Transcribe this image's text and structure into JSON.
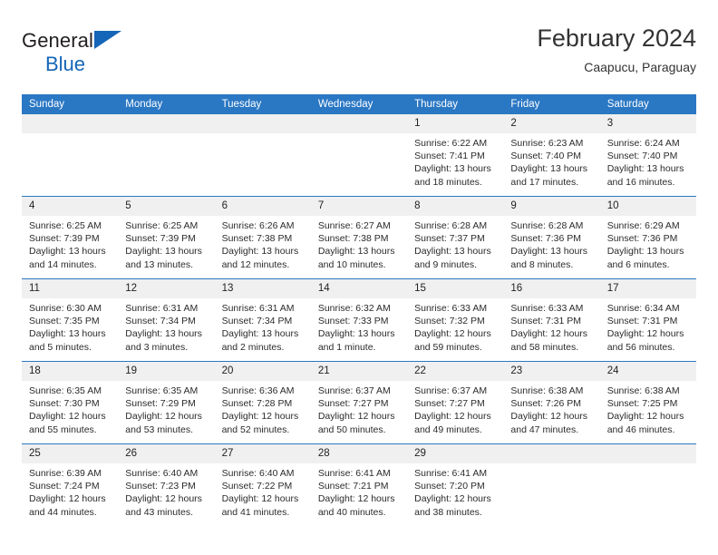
{
  "brand": {
    "name_top": "General",
    "name_bottom": "Blue",
    "triangle_color": "#1565b8",
    "icon": "triangle-icon"
  },
  "header": {
    "title": "February 2024",
    "subtitle": "Caapucu, Paraguay"
  },
  "theme": {
    "header_bg": "#2a77c4",
    "header_text": "#ffffff",
    "daynum_bg": "#f0f0f0",
    "grid_line": "#2a77c4",
    "body_text": "#2b2b2b"
  },
  "weekday_headers": [
    "Sunday",
    "Monday",
    "Tuesday",
    "Wednesday",
    "Thursday",
    "Friday",
    "Saturday"
  ],
  "labels": {
    "sunrise_prefix": "Sunrise:",
    "sunset_prefix": "Sunset:",
    "daylight_prefix": "Daylight:"
  },
  "weeks": [
    [
      {
        "day": "",
        "blank": true
      },
      {
        "day": "",
        "blank": true
      },
      {
        "day": "",
        "blank": true
      },
      {
        "day": "",
        "blank": true
      },
      {
        "day": "1",
        "sunrise": "Sunrise: 6:22 AM",
        "sunset": "Sunset: 7:41 PM",
        "daylight": "Daylight: 13 hours and 18 minutes."
      },
      {
        "day": "2",
        "sunrise": "Sunrise: 6:23 AM",
        "sunset": "Sunset: 7:40 PM",
        "daylight": "Daylight: 13 hours and 17 minutes."
      },
      {
        "day": "3",
        "sunrise": "Sunrise: 6:24 AM",
        "sunset": "Sunset: 7:40 PM",
        "daylight": "Daylight: 13 hours and 16 minutes."
      }
    ],
    [
      {
        "day": "4",
        "sunrise": "Sunrise: 6:25 AM",
        "sunset": "Sunset: 7:39 PM",
        "daylight": "Daylight: 13 hours and 14 minutes."
      },
      {
        "day": "5",
        "sunrise": "Sunrise: 6:25 AM",
        "sunset": "Sunset: 7:39 PM",
        "daylight": "Daylight: 13 hours and 13 minutes."
      },
      {
        "day": "6",
        "sunrise": "Sunrise: 6:26 AM",
        "sunset": "Sunset: 7:38 PM",
        "daylight": "Daylight: 13 hours and 12 minutes."
      },
      {
        "day": "7",
        "sunrise": "Sunrise: 6:27 AM",
        "sunset": "Sunset: 7:38 PM",
        "daylight": "Daylight: 13 hours and 10 minutes."
      },
      {
        "day": "8",
        "sunrise": "Sunrise: 6:28 AM",
        "sunset": "Sunset: 7:37 PM",
        "daylight": "Daylight: 13 hours and 9 minutes."
      },
      {
        "day": "9",
        "sunrise": "Sunrise: 6:28 AM",
        "sunset": "Sunset: 7:36 PM",
        "daylight": "Daylight: 13 hours and 8 minutes."
      },
      {
        "day": "10",
        "sunrise": "Sunrise: 6:29 AM",
        "sunset": "Sunset: 7:36 PM",
        "daylight": "Daylight: 13 hours and 6 minutes."
      }
    ],
    [
      {
        "day": "11",
        "sunrise": "Sunrise: 6:30 AM",
        "sunset": "Sunset: 7:35 PM",
        "daylight": "Daylight: 13 hours and 5 minutes."
      },
      {
        "day": "12",
        "sunrise": "Sunrise: 6:31 AM",
        "sunset": "Sunset: 7:34 PM",
        "daylight": "Daylight: 13 hours and 3 minutes."
      },
      {
        "day": "13",
        "sunrise": "Sunrise: 6:31 AM",
        "sunset": "Sunset: 7:34 PM",
        "daylight": "Daylight: 13 hours and 2 minutes."
      },
      {
        "day": "14",
        "sunrise": "Sunrise: 6:32 AM",
        "sunset": "Sunset: 7:33 PM",
        "daylight": "Daylight: 13 hours and 1 minute."
      },
      {
        "day": "15",
        "sunrise": "Sunrise: 6:33 AM",
        "sunset": "Sunset: 7:32 PM",
        "daylight": "Daylight: 12 hours and 59 minutes."
      },
      {
        "day": "16",
        "sunrise": "Sunrise: 6:33 AM",
        "sunset": "Sunset: 7:31 PM",
        "daylight": "Daylight: 12 hours and 58 minutes."
      },
      {
        "day": "17",
        "sunrise": "Sunrise: 6:34 AM",
        "sunset": "Sunset: 7:31 PM",
        "daylight": "Daylight: 12 hours and 56 minutes."
      }
    ],
    [
      {
        "day": "18",
        "sunrise": "Sunrise: 6:35 AM",
        "sunset": "Sunset: 7:30 PM",
        "daylight": "Daylight: 12 hours and 55 minutes."
      },
      {
        "day": "19",
        "sunrise": "Sunrise: 6:35 AM",
        "sunset": "Sunset: 7:29 PM",
        "daylight": "Daylight: 12 hours and 53 minutes."
      },
      {
        "day": "20",
        "sunrise": "Sunrise: 6:36 AM",
        "sunset": "Sunset: 7:28 PM",
        "daylight": "Daylight: 12 hours and 52 minutes."
      },
      {
        "day": "21",
        "sunrise": "Sunrise: 6:37 AM",
        "sunset": "Sunset: 7:27 PM",
        "daylight": "Daylight: 12 hours and 50 minutes."
      },
      {
        "day": "22",
        "sunrise": "Sunrise: 6:37 AM",
        "sunset": "Sunset: 7:27 PM",
        "daylight": "Daylight: 12 hours and 49 minutes."
      },
      {
        "day": "23",
        "sunrise": "Sunrise: 6:38 AM",
        "sunset": "Sunset: 7:26 PM",
        "daylight": "Daylight: 12 hours and 47 minutes."
      },
      {
        "day": "24",
        "sunrise": "Sunrise: 6:38 AM",
        "sunset": "Sunset: 7:25 PM",
        "daylight": "Daylight: 12 hours and 46 minutes."
      }
    ],
    [
      {
        "day": "25",
        "sunrise": "Sunrise: 6:39 AM",
        "sunset": "Sunset: 7:24 PM",
        "daylight": "Daylight: 12 hours and 44 minutes."
      },
      {
        "day": "26",
        "sunrise": "Sunrise: 6:40 AM",
        "sunset": "Sunset: 7:23 PM",
        "daylight": "Daylight: 12 hours and 43 minutes."
      },
      {
        "day": "27",
        "sunrise": "Sunrise: 6:40 AM",
        "sunset": "Sunset: 7:22 PM",
        "daylight": "Daylight: 12 hours and 41 minutes."
      },
      {
        "day": "28",
        "sunrise": "Sunrise: 6:41 AM",
        "sunset": "Sunset: 7:21 PM",
        "daylight": "Daylight: 12 hours and 40 minutes."
      },
      {
        "day": "29",
        "sunrise": "Sunrise: 6:41 AM",
        "sunset": "Sunset: 7:20 PM",
        "daylight": "Daylight: 12 hours and 38 minutes."
      },
      {
        "day": "",
        "blank": true
      },
      {
        "day": "",
        "blank": true
      }
    ]
  ]
}
